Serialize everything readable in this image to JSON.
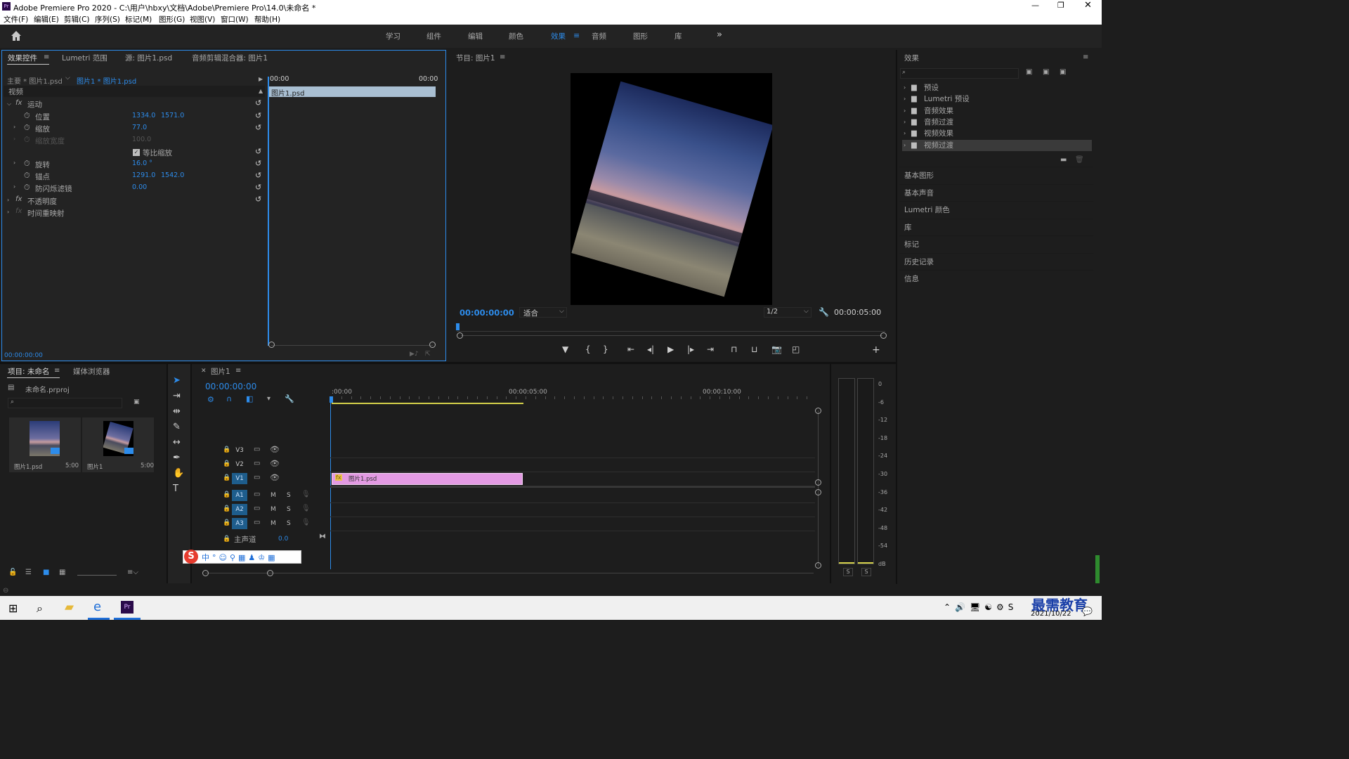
{
  "app": {
    "title": "Adobe Premiere Pro 2020 - C:\\用户\\hbxy\\文档\\Adobe\\Premiere Pro\\14.0\\未命名 *",
    "icon": "Pr"
  },
  "menu": [
    "文件(F)",
    "编辑(E)",
    "剪辑(C)",
    "序列(S)",
    "标记(M)",
    "图形(G)",
    "视图(V)",
    "窗口(W)",
    "帮助(H)"
  ],
  "workspaces": [
    "学习",
    "组件",
    "编辑",
    "颜色",
    "效果",
    "音频",
    "图形",
    "库"
  ],
  "active_workspace": "效果",
  "effect_controls": {
    "tabs": [
      "效果控件",
      "Lumetri 范围",
      "源: 图片1.psd",
      "音频剪辑混合器: 图片1"
    ],
    "master": "主要 * 图片1.psd",
    "clip": "图片1 * 图片1.psd",
    "t_start": "00:00",
    "t_end": "00:00",
    "clip_label": "图片1.psd",
    "section": "视频",
    "motion": "运动",
    "props": [
      {
        "label": "位置",
        "v1": "1334.0",
        "v2": "1571.0"
      },
      {
        "label": "缩放",
        "v1": "77.0"
      },
      {
        "label": "缩放宽度",
        "v1": "100.0"
      },
      {
        "label": "等比缩放"
      },
      {
        "label": "旋转",
        "v1": "16.0 °"
      },
      {
        "label": "锚点",
        "v1": "1291.0",
        "v2": "1542.0"
      },
      {
        "label": "防闪烁滤镜",
        "v1": "0.00"
      }
    ],
    "opacity": "不透明度",
    "time_remap": "时间重映射",
    "timecode": "00:00:00:00"
  },
  "program": {
    "title": "节目: 图片1",
    "timecode": "00:00:00:00",
    "fit": "适合",
    "resolution": "1/2",
    "duration": "00:00:05:00"
  },
  "effects_panel": {
    "title": "效果",
    "folders": [
      "预设",
      "Lumetri 预设",
      "音频效果",
      "音频过渡",
      "视频效果",
      "视频过渡"
    ],
    "selected": "视频过渡",
    "panels": [
      "基本图形",
      "基本声音",
      "Lumetri 颜色",
      "库",
      "标记",
      "历史记录",
      "信息"
    ]
  },
  "project": {
    "tabs": [
      "项目: 未命名",
      "媒体浏览器"
    ],
    "file": "未命名.prproj",
    "items": [
      {
        "name": "图片1.psd",
        "dur": "5:00"
      },
      {
        "name": "图片1",
        "dur": "5:00"
      }
    ]
  },
  "timeline": {
    "tab": "图片1",
    "timecode": "00:00:00:00",
    "ruler": [
      ":00:00",
      "00:00:05:00",
      "00:00:10:00"
    ],
    "video_tracks": [
      "V3",
      "V2",
      "V1"
    ],
    "audio_tracks": [
      "A1",
      "A2",
      "A3"
    ],
    "master_label": "主声道",
    "master_value": "0.0",
    "clip_label": "图片1.psd",
    "m": "M",
    "s": "S"
  },
  "meter": {
    "scale": [
      "0",
      "-6",
      "-12",
      "-18",
      "-24",
      "-30",
      "-36",
      "-42",
      "-48",
      "-54",
      "dB"
    ],
    "solo": [
      "S",
      "S"
    ]
  },
  "taskbar": {
    "time": "",
    "date": "2021/10/22",
    "watermark": "最需教育"
  }
}
